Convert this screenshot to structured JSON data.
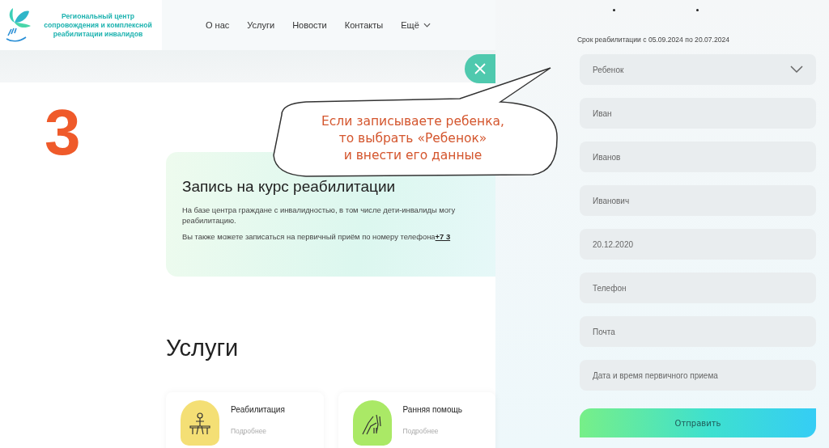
{
  "header": {
    "logo_text": "Региональный центр сопровождения и комплексной реабилитации инвалидов",
    "nav": [
      {
        "label": "О нас",
        "kind": "link"
      },
      {
        "label": "Услуги",
        "kind": "link"
      },
      {
        "label": "Новости",
        "kind": "link"
      },
      {
        "label": "Контакты",
        "kind": "link"
      },
      {
        "label": "Ещё",
        "kind": "dropdown"
      }
    ]
  },
  "step_number": "3",
  "callout": "Если записываете ребенка,\nто выбрать «Ребенок»\nи внести его данные",
  "enroll_card": {
    "title": "Запись на курс реабилитации",
    "text": "На базе центра граждане с инвалидностью, в том числе дети-инвалиды могу",
    "text_2": "реабилитацию.",
    "phone_text": "Вы также можете записаться на первичный приём по номеру телефона",
    "phone_link": "+7 3"
  },
  "services": {
    "title": "Услуги",
    "items": [
      {
        "name": "Реабилитация",
        "more": "Подробнее",
        "color": "#f7df6a"
      },
      {
        "name": "Ранняя помощь",
        "more": "Подробнее",
        "color": "#a6ec5a"
      }
    ]
  },
  "form": {
    "period": "Срок реабилитации с 05.09.2024 по 20.07.2024",
    "fields": [
      {
        "kind": "select",
        "value": "Ребенок"
      },
      {
        "kind": "text",
        "value": "Иван"
      },
      {
        "kind": "text",
        "value": "Иванов"
      },
      {
        "kind": "text",
        "value": "Иванович"
      },
      {
        "kind": "text",
        "value": "20.12.2020"
      },
      {
        "kind": "text",
        "placeholder": "Телефон"
      },
      {
        "kind": "text",
        "placeholder": "Почта"
      },
      {
        "kind": "text",
        "placeholder": "Дата и время первичного приема"
      }
    ],
    "submit": "Отправить"
  }
}
